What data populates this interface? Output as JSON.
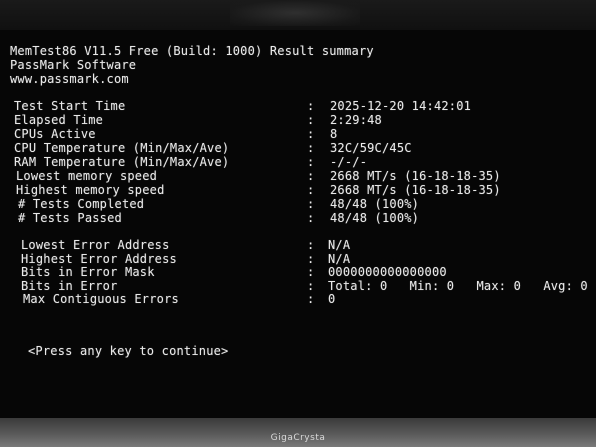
{
  "header": {
    "title": "MemTest86 V11.5 Free (Build: 1000) Result summary",
    "company": "PassMark Software",
    "url": "www.passmark.com"
  },
  "summary": [
    {
      "label": "Test Start Time",
      "value": "2025-12-20 14:42:01"
    },
    {
      "label": "Elapsed Time",
      "value": "2:29:48"
    },
    {
      "label": "CPUs Active",
      "value": "8"
    },
    {
      "label": "CPU Temperature (Min/Max/Ave)",
      "value": "32C/59C/45C"
    },
    {
      "label": "RAM Temperature (Min/Max/Ave)",
      "value": "-/-/-"
    },
    {
      "label": "Lowest memory speed",
      "value": "2668 MT/s (16-18-18-35)"
    },
    {
      "label": "Highest memory speed",
      "value": "2668 MT/s (16-18-18-35)"
    },
    {
      "label": "# Tests Completed",
      "value": "48/48 (100%)"
    },
    {
      "label": "# Tests Passed",
      "value": "48/48 (100%)"
    }
  ],
  "errors": [
    {
      "label": "Lowest Error Address",
      "value": "N/A"
    },
    {
      "label": "Highest Error Address",
      "value": "N/A"
    },
    {
      "label": "Bits in Error Mask",
      "value": "0000000000000000"
    },
    {
      "label": "Bits in Error",
      "value": "Total: 0   Min: 0   Max: 0   Avg: 0"
    },
    {
      "label": "Max Contiguous Errors",
      "value": "0"
    }
  ],
  "separator": ":",
  "prompt": "<Press any key to continue>",
  "monitor_brand": "GigaCrysta"
}
